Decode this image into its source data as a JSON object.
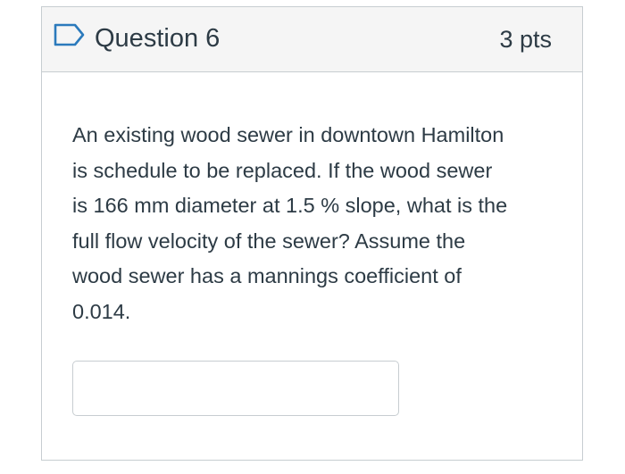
{
  "question": {
    "title": "Question 6",
    "points": "3 pts",
    "flag_icon": "flag-icon",
    "text_lines": [
      "An existing wood sewer in downtown Hamilton",
      "is schedule to be replaced.  If the wood sewer",
      "is 166 mm diameter at 1.5 % slope, what is the",
      "full flow velocity of the sewer?  Assume the",
      "wood sewer has a mannings coefficient of",
      "0.014."
    ]
  },
  "answer": {
    "value": "",
    "placeholder": ""
  },
  "colors": {
    "header_background": "#f5f5f5",
    "border": "#c7cdd1",
    "text": "#2d3b45",
    "flag_accent": "#2b7abc"
  }
}
